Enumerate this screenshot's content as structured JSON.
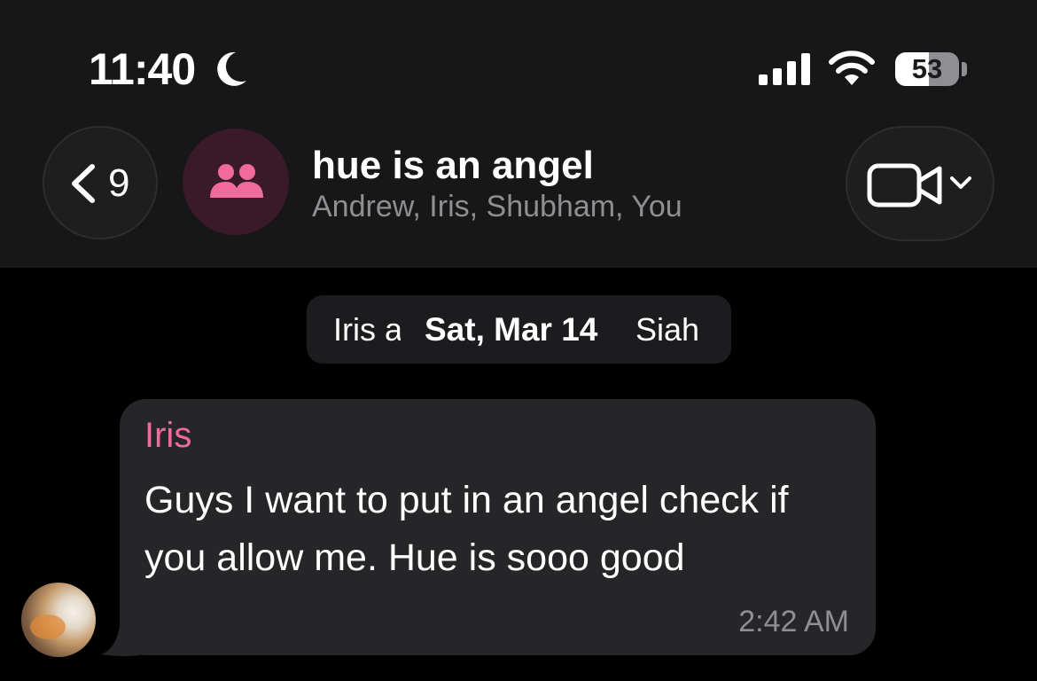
{
  "status_bar": {
    "time": "11:40",
    "focus_icon": "moon-icon",
    "signal_icon": "cellular-signal-icon",
    "wifi_icon": "wifi-icon",
    "battery_level": "53",
    "battery_fraction": 0.53
  },
  "nav": {
    "back_count": "9",
    "back_icon": "chevron-left-icon",
    "group_icon": "people-icon",
    "title": "hue is an angel",
    "members": "Andrew, Iris, Shubham, You",
    "video_icon": "video-camera-icon",
    "video_menu_icon": "chevron-down-icon"
  },
  "date_pill": {
    "left_text": "Iris a",
    "date": "Sat, Mar 14",
    "right_text": "Siah"
  },
  "messages": [
    {
      "sender": "Iris",
      "text": "Guys I want to put in an angel check if you allow me. Hue is sooo good",
      "time": "2:42 AM"
    }
  ],
  "colors": {
    "header_bg": "#171717",
    "accent_pink": "#f06b9b",
    "bubble_bg": "#262628",
    "secondary_text": "#8e8e93"
  }
}
